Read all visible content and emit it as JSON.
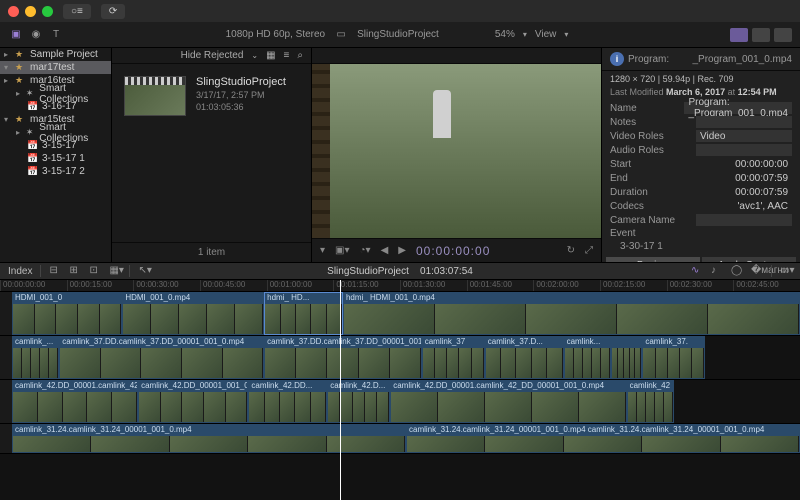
{
  "titlebar": {
    "tool1": "○≡",
    "tool2": "⟳"
  },
  "toolbar": {
    "hide_rejected": "Hide Rejected",
    "format": "1080p HD 60p, Stereo",
    "project_name": "SlingStudioProject",
    "zoom": "54%",
    "view": "View"
  },
  "sidebar": {
    "items": [
      {
        "label": "Sample Project",
        "expand": "▸",
        "level": 0
      },
      {
        "label": "mar17test",
        "expand": "▾",
        "level": 0,
        "sel": true
      },
      {
        "label": "mar16test",
        "expand": "▸",
        "level": 0
      },
      {
        "label": "Smart Collections",
        "expand": "▸",
        "level": 1,
        "ico": "✶"
      },
      {
        "label": "3-16-17",
        "expand": "",
        "level": 1,
        "ico": "📅"
      },
      {
        "label": "mar15test",
        "expand": "▾",
        "level": 0
      },
      {
        "label": "Smart Collections",
        "expand": "▸",
        "level": 1,
        "ico": "✶"
      },
      {
        "label": "3-15-17",
        "expand": "",
        "level": 1,
        "ico": "📅"
      },
      {
        "label": "3-15-17 1",
        "expand": "",
        "level": 1,
        "ico": "📅"
      },
      {
        "label": "3-15-17 2",
        "expand": "",
        "level": 1,
        "ico": "📅"
      }
    ]
  },
  "browser": {
    "hide_rejected": "Hide Rejected",
    "clip_title": "SlingStudioProject",
    "clip_date": "3/17/17, 2:57 PM",
    "clip_dur": "01:03:05:36",
    "footer": "1 item"
  },
  "viewer": {
    "play_tc": "00:00:00:00"
  },
  "inspector": {
    "program_lbl": "Program:",
    "program_file": "_Program_001_0.mp4",
    "resolution": "1280 × 720 | 59.94p | Rec. 709",
    "modified_lbl": "Last Modified",
    "modified_date": "March 6, 2017",
    "modified_at": "at",
    "modified_time": "12:54 PM",
    "rows": [
      {
        "key": "Name",
        "val": "Program:    _Program_001_0.mp4",
        "field": true
      },
      {
        "key": "Notes",
        "val": "",
        "field": true
      },
      {
        "key": "Video Roles",
        "val": "Video",
        "field": true
      },
      {
        "key": "Audio Roles",
        "val": "",
        "field": true
      },
      {
        "key": "Start",
        "val": "00:00:00:00"
      },
      {
        "key": "End",
        "val": "00:00:07:59"
      },
      {
        "key": "Duration",
        "val": "00:00:07:59"
      },
      {
        "key": "Codecs",
        "val": "'avc1', AAC"
      },
      {
        "key": "Camera Name",
        "val": "",
        "field": true
      }
    ],
    "event_lbl": "Event",
    "event_val": "3-30-17 1",
    "basic": "Basic",
    "apply": "Apply Custom Name"
  },
  "timeline": {
    "index": "Index",
    "title": "SlingStudioProject",
    "duration": "01:03:07:54",
    "ruler": [
      "00:00:00:00",
      "00:00:15:00",
      "00:00:30:00",
      "00:00:45:00",
      "00:01:00:00",
      "00:01:15:00",
      "00:01:30:00",
      "00:01:45:00",
      "00:02:00:00",
      "00:02:15:00",
      "00:02:30:00",
      "00:02:45:00"
    ],
    "tracks": [
      {
        "clips": [
          {
            "label": "HDMI_001_0",
            "w": 14
          },
          {
            "label": "HDMI_001_0.mp4",
            "w": 18
          },
          {
            "label": "hdmi_   HD...",
            "w": 10,
            "active": true
          },
          {
            "label": "hdmi_  HDMI_001_0.mp4",
            "w": 58
          }
        ]
      },
      {
        "clips": [
          {
            "label": "camlink_...",
            "w": 6
          },
          {
            "label": "camlink_37.DD.camlink_37.DD_00001_001_0.mp4",
            "w": 26
          },
          {
            "label": "camlink_37.DD.camlink_37.DD_00001_001_0.mp4",
            "w": 20
          },
          {
            "label": "camlink_37",
            "w": 8
          },
          {
            "label": "camlink_37.D...",
            "w": 10
          },
          {
            "label": "camlink...",
            "w": 6
          },
          {
            "label": "",
            "w": 4
          },
          {
            "label": "camlink_37.",
            "w": 8
          }
        ]
      },
      {
        "clips": [
          {
            "label": "camlink_42.DD_00001.camlink_42_DD_00001_001_0.mp4",
            "w": 16
          },
          {
            "label": "camlink_42.DD_00001_001_0.mp4",
            "w": 14
          },
          {
            "label": "camlink_42.DD...",
            "w": 10
          },
          {
            "label": "camlink_42.D...",
            "w": 8
          },
          {
            "label": "camlink_42.DD_00001.camlink_42_DD_00001_001_0.mp4",
            "w": 30
          },
          {
            "label": "camlink_42",
            "w": 6
          }
        ]
      },
      {
        "short": true,
        "clips": [
          {
            "label": "camlink_31.24.camlink_31.24_00001_001_0.mp4",
            "w": 50
          },
          {
            "label": "camlink_31.24.camlink_31.24_00001_001_0.mp4 camlink_31.24.camlink_31.24_00001_001_0.mp4",
            "w": 50
          }
        ]
      }
    ]
  }
}
